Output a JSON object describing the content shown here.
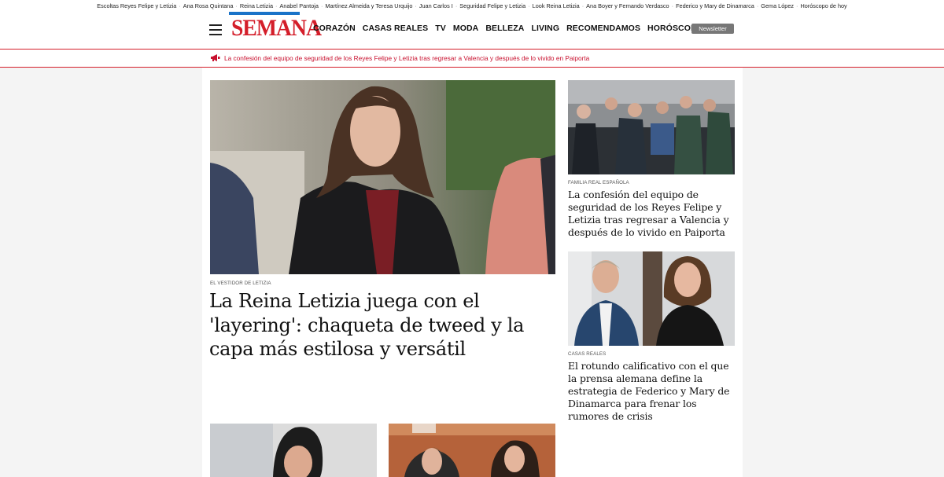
{
  "topbar": {
    "tags": [
      "Escoltas Reyes Felipe y Letizia",
      "Ana Rosa Quintana",
      "Reina Letizia",
      "Anabel Pantoja",
      "Martínez Almeida y Teresa Urquijo",
      "Juan Carlos I",
      "Seguridad Felipe y Letizia",
      "Look Reina Letizia",
      "Ana Boyer y Fernando Verdasco",
      "Federico y Mary de Dinamarca",
      "Gema López",
      "Horóscopo de hoy"
    ]
  },
  "header": {
    "logo_text": "SEMANA",
    "nav": [
      "CORAZÓN",
      "CASAS REALES",
      "TV",
      "MODA",
      "BELLEZA",
      "LIVING",
      "RECOMENDAMOS",
      "HORÓSCOPO"
    ],
    "newsletter_label": "Newsletter"
  },
  "breaking": {
    "icon": "megaphone-icon",
    "text": "La confesión del equipo de seguridad de los Reyes Felipe y Letizia tras regresar a Valencia y después de lo vivido en Paiporta"
  },
  "main_article": {
    "kicker": "EL VESTIDOR DE LETIZIA",
    "title": "La Reina Letizia juega con el 'layering': chaqueta de tweed y la capa más estilosa y versátil"
  },
  "side_articles": [
    {
      "kicker": "FAMILIA REAL ESPAÑOLA",
      "title": "La confesión del equipo de seguridad de los Reyes Felipe y Letizia tras regresar a Valencia y después de lo vivido en Paiporta"
    },
    {
      "kicker": "CASAS REALES",
      "title": "El rotundo calificativo con el que la prensa alemana define la estrategia de Federico y Mary de Dinamarca para frenar los rumores de crisis"
    }
  ],
  "colors": {
    "brand_red": "#d41e2a",
    "brand_blue": "#1a73c8",
    "breaking_red": "#c8102e"
  }
}
